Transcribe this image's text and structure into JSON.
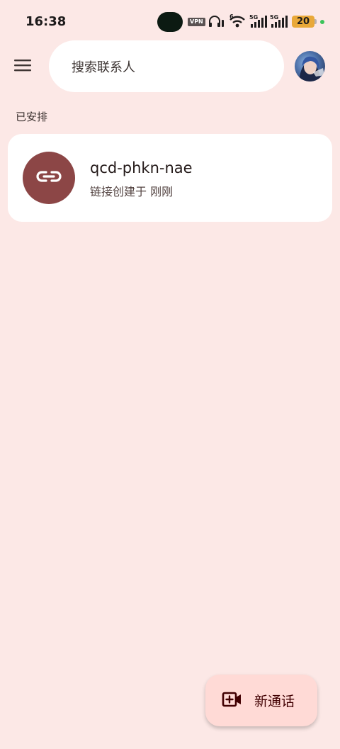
{
  "status_bar": {
    "time": "16:38",
    "vpn_label": "VPN",
    "signal_1_label": "5G",
    "signal_2_label": "5G",
    "wifi_label": "6",
    "battery": "20"
  },
  "top_bar": {
    "search_placeholder": "搜索联系人"
  },
  "section": {
    "label": "已安排"
  },
  "meeting_card": {
    "title": "qcd-phkn-nae",
    "subtitle": "链接创建于 刚刚"
  },
  "fab": {
    "label": "新通话"
  },
  "colors": {
    "background": "#fce8e6",
    "link_circle": "#8c4646",
    "fab_background": "#ffdad6",
    "battery": "#e9a838"
  },
  "icons": [
    "menu-icon",
    "avatar",
    "link-icon",
    "video-call-add-icon",
    "wifi-icon",
    "headphones-icon",
    "signal-icon"
  ]
}
